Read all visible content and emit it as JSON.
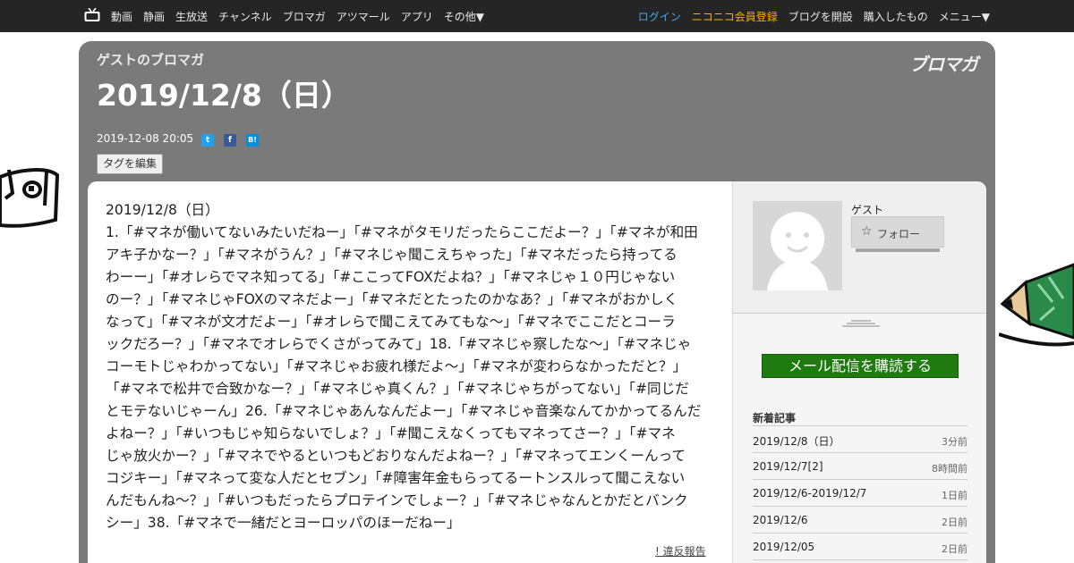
{
  "nav": {
    "items": [
      "動画",
      "静画",
      "生放送",
      "チャンネル",
      "ブロマガ",
      "アツマール",
      "アプリ",
      "その他▼"
    ],
    "login": "ログイン",
    "register": "ニコニコ会員登録",
    "open_blog": "ブログを開設",
    "purchased": "購入したもの",
    "menu": "メニュー▼"
  },
  "header": {
    "blog_name": "ゲストのブロマガ",
    "logo_text": "ブロマガ",
    "title": "2019/12/8（日）",
    "date": "2019-12-08 20:05",
    "share": {
      "twitter": "t",
      "facebook": "f",
      "hatena": "B!"
    },
    "tag_edit": "タグを編集"
  },
  "article": {
    "lines": [
      "2019/12/8（日）",
      "1.「#マネが働いてないみたいだねー」「#マネがタモリだったらここだよー？」「#マネが和田",
      "アキ子かなー？」「#マネがうん？」「#マネじゃ聞こえちゃった」「#マネだったら持ってる",
      "わーー」「#オレらでマネ知ってる」「#ここってFOXだよね？」「#マネじゃ１０円じゃない",
      "のー？」「#マネじゃFOXのマネだよー」「#マネだとたったのかなあ？」「#マネがおかしく",
      "なって」「#マネが文才だよー」「#オレらで聞こえてみてもな〜」「#マネでここだとコーラ",
      "ックだろー？」「#マネでオレらでくさがってみて」18.「#マネじゃ察したな〜」「#マネじゃ",
      "コーモトじゃわかってない」「#マネじゃお疲れ様だよ〜」「#マネが変わらなかっただと？」",
      "「#マネで松井で合致かなー？」「#マネじゃ真くん？」「#マネじゃちがってない」「#同じだ",
      "とモテないじゃーん」26.「#マネじゃあんなんだよー」「#マネじゃ音楽なんてかかってるんだ",
      "よねー？」「#いつもじゃ知らないでしょ？」「#聞こえなくってもマネってさー？」「#マネ",
      "じゃ放火かー？」「#マネでやるといつもどおりなんだよねー？」「#マネってエンくーんって",
      "コジキー」「#マネって変な人だとセブン」「#障害年金もらってるートンスルって聞こえない",
      "んだもんね〜？」「#いつもだったらプロテインでしょー？」「#マネじゃなんとかだとバンク",
      "シー」38.「#マネで一緒だとヨーロッパのほーだねー」"
    ],
    "report": "! 違反報告"
  },
  "sidebar": {
    "guest_name": "ゲスト",
    "follow": "フォロー",
    "subscribe": "メール配信を購読する",
    "recent_title": "新着記事",
    "recent": [
      {
        "title": "2019/12/8（日）",
        "ago": "3分前"
      },
      {
        "title": "2019/12/7[2]",
        "ago": "8時間前"
      },
      {
        "title": "2019/12/6-2019/12/7",
        "ago": "1日前"
      },
      {
        "title": "2019/12/6",
        "ago": "2日前"
      },
      {
        "title": "2019/12/05",
        "ago": "2日前"
      }
    ]
  },
  "colors": {
    "topbar": "#252525",
    "frame": "#7a7a7a",
    "login": "#46a6e8",
    "register": "#f5b300",
    "subscribe": "#1f7a0f"
  }
}
